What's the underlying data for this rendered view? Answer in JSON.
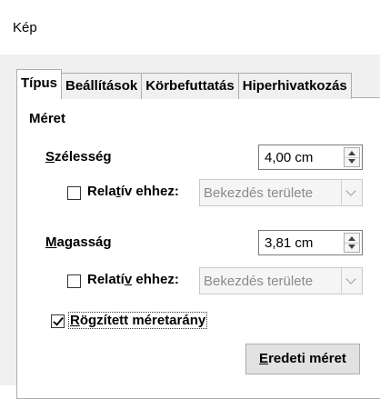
{
  "window": {
    "title": "Kép"
  },
  "tabs": [
    {
      "label": "Típus",
      "active": true
    },
    {
      "label": "Beállítások",
      "active": false
    },
    {
      "label": "Körbefuttatás",
      "active": false
    },
    {
      "label": "Hiperhivatkozás",
      "active": false
    }
  ],
  "size": {
    "section_title": "Méret",
    "width_label_accel": "S",
    "width_label_rest": "zélesség",
    "width_value": "4,00 cm",
    "width_relative_label_a": "Rela",
    "width_relative_label_accel": "t",
    "width_relative_label_b": "ív ehhez:",
    "width_relative_checked": false,
    "width_relative_value": "Bekezdés területe",
    "height_label_accel": "M",
    "height_label_rest": "agasság",
    "height_value": "3,81 cm",
    "height_relative_label_a": "Relatí",
    "height_relative_label_accel": "v",
    "height_relative_label_b": " ehhez:",
    "height_relative_checked": false,
    "height_relative_value": "Bekezdés területe",
    "keep_ratio_label_accel": "R",
    "keep_ratio_label_rest": "ögzített méretarány",
    "keep_ratio_checked": true,
    "original_size_accel": "E",
    "original_size_rest": "redeti méret"
  }
}
